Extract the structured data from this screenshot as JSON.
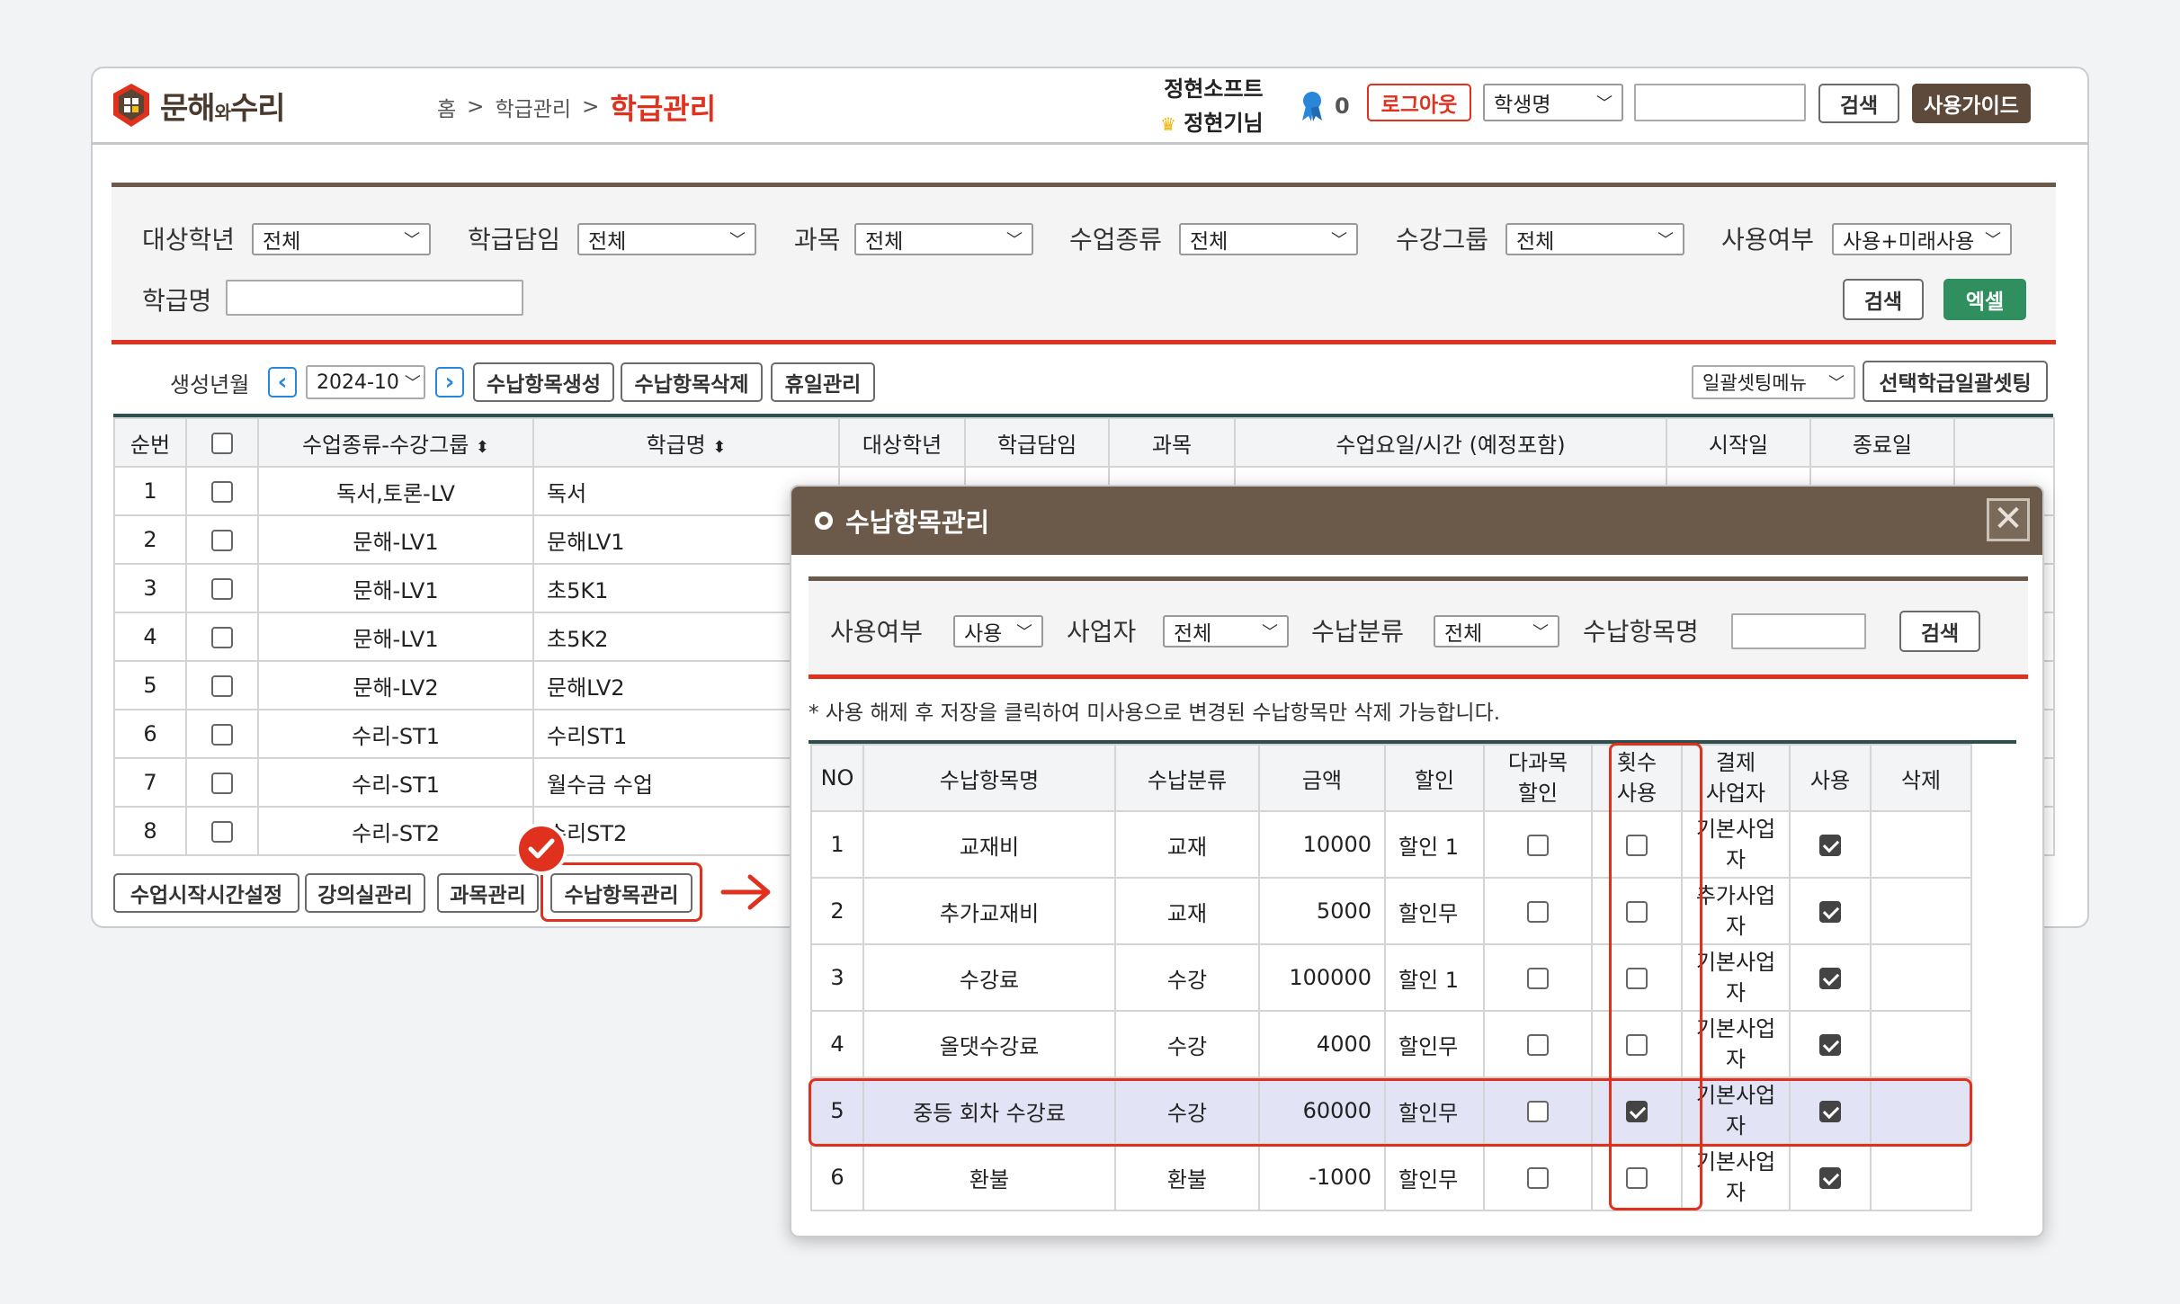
{
  "header": {
    "logo_text": "문해",
    "logo_small": "와",
    "logo_text2": "수리",
    "breadcrumb": [
      "홈",
      ">",
      "학급관리",
      ">"
    ],
    "page_title": "학급관리",
    "company": "정현소프트",
    "user_name": "정현기님",
    "notice_count": "0",
    "logout_label": "로그아웃",
    "search_type": "학생명",
    "search_label": "검색",
    "guide_label": "사용가이드"
  },
  "filters": {
    "grade_label": "대상학년",
    "grade_value": "전체",
    "teacher_label": "학급담임",
    "teacher_value": "전체",
    "subject_label": "과목",
    "subject_value": "전체",
    "classtype_label": "수업종류",
    "classtype_value": "전체",
    "group_label": "수강그룹",
    "group_value": "전체",
    "use_label": "사용여부",
    "use_value": "사용+미래사용",
    "classname_label": "학급명",
    "search_label": "검색",
    "excel_label": "엑셀"
  },
  "toolbar": {
    "month_label": "생성년월",
    "month_value": "2024-10",
    "create_label": "수납항목생성",
    "delete_label": "수납항목삭제",
    "holiday_label": "휴일관리",
    "batch_menu_label": "일괄셋팅메뉴",
    "batch_apply_label": "선택학급일괄셋팅"
  },
  "class_table": {
    "headers": [
      "순번",
      "수업종류-수강그룹",
      "학급명",
      "대상학년",
      "학급담임",
      "과목",
      "수업요일/시간 (예정포함)",
      "시작일",
      "종료일"
    ],
    "rows": [
      {
        "no": "1",
        "group": "독서,토론-LV",
        "name": "독서"
      },
      {
        "no": "2",
        "group": "문해-LV1",
        "name": "문해LV1"
      },
      {
        "no": "3",
        "group": "문해-LV1",
        "name": "초5K1"
      },
      {
        "no": "4",
        "group": "문해-LV1",
        "name": "초5K2"
      },
      {
        "no": "5",
        "group": "문해-LV2",
        "name": "문해LV2"
      },
      {
        "no": "6",
        "group": "수리-ST1",
        "name": "수리ST1"
      },
      {
        "no": "7",
        "group": "수리-ST1",
        "name": "월수금 수업"
      },
      {
        "no": "8",
        "group": "수리-ST2",
        "name": "수리ST2"
      }
    ]
  },
  "bottom_buttons": {
    "start_time": "수업시작시간설정",
    "room": "강의실관리",
    "subject": "과목관리",
    "payment_items": "수납항목관리"
  },
  "modal": {
    "title": "수납항목관리",
    "use_label": "사용여부",
    "use_value": "사용",
    "biz_label": "사업자",
    "biz_value": "전체",
    "category_label": "수납분류",
    "category_value": "전체",
    "item_label": "수납항목명",
    "search_label": "검색",
    "notice": "* 사용 해제 후 저장을 클릭하여 미사용으로 변경된 수납항목만 삭제 가능합니다.",
    "headers": {
      "no": "NO",
      "name": "수납항목명",
      "category": "수납분류",
      "amount": "금액",
      "discount": "할인",
      "multi_1": "다과목",
      "multi_2": "할인",
      "count_1": "횟수",
      "count_2": "사용",
      "biz_1": "결제",
      "biz_2": "사업자",
      "use": "사용",
      "del": "삭제"
    },
    "rows": [
      {
        "no": "1",
        "name": "교재비",
        "category": "교재",
        "amount": "10000",
        "discount": "할인 1",
        "biz_1": "기본사업",
        "biz_2": "자",
        "multi": false,
        "count": false,
        "use": true
      },
      {
        "no": "2",
        "name": "추가교재비",
        "category": "교재",
        "amount": "5000",
        "discount": "할인무",
        "biz_1": "추가사업",
        "biz_2": "자",
        "multi": false,
        "count": false,
        "use": true
      },
      {
        "no": "3",
        "name": "수강료",
        "category": "수강",
        "amount": "100000",
        "discount": "할인 1",
        "biz_1": "기본사업",
        "biz_2": "자",
        "multi": false,
        "count": false,
        "use": true
      },
      {
        "no": "4",
        "name": "올댓수강료",
        "category": "수강",
        "amount": "4000",
        "discount": "할인무",
        "biz_1": "기본사업",
        "biz_2": "자",
        "multi": false,
        "count": false,
        "use": true
      },
      {
        "no": "5",
        "name": "중등 회차 수강료",
        "category": "수강",
        "amount": "60000",
        "discount": "할인무",
        "biz_1": "기본사업",
        "biz_2": "자",
        "multi": false,
        "count": true,
        "use": true
      },
      {
        "no": "6",
        "name": "환불",
        "category": "환불",
        "amount": "-1000",
        "discount": "할인무",
        "biz_1": "기본사업",
        "biz_2": "자",
        "multi": false,
        "count": false,
        "use": true
      }
    ]
  },
  "colors": {
    "accent_red": "#e0301e",
    "brown": "#6b5a4a",
    "green": "#2f8f5e",
    "highlight": "#e3e3f6"
  }
}
